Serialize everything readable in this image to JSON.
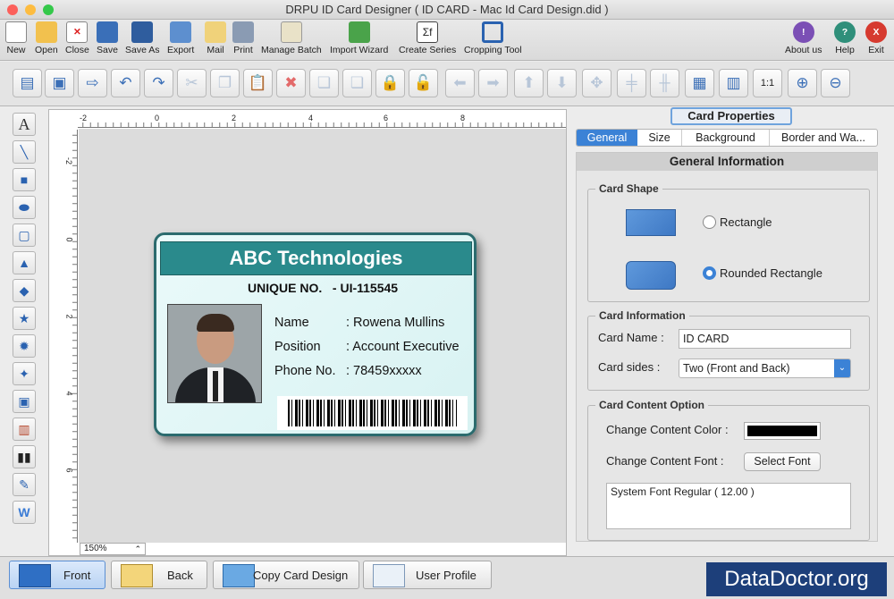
{
  "window": {
    "title": "DRPU ID Card Designer ( ID CARD - Mac Id Card Design.did )"
  },
  "toolbar": {
    "items": [
      "New",
      "Open",
      "Close",
      "Save",
      "Save As",
      "Export",
      "Mail",
      "Print",
      "Manage Batch",
      "Import Wizard",
      "Create Series",
      "Cropping Tool"
    ],
    "right": [
      "About us",
      "Help",
      "Exit"
    ]
  },
  "canvas": {
    "zoom": "150%",
    "ruler_top": [
      "-2",
      "0",
      "2",
      "4",
      "6",
      "8"
    ],
    "ruler_left": [
      "-2",
      "0",
      "2",
      "4",
      "6"
    ]
  },
  "card": {
    "company": "ABC Technologies",
    "unique_label": "UNIQUE NO.",
    "unique_value": "- UI-115545",
    "fields": [
      {
        "label": "Name",
        "value": ": Rowena Mullins"
      },
      {
        "label": "Position",
        "value": ": Account Executive"
      },
      {
        "label": "Phone No.",
        "value": ": 78459xxxxx"
      }
    ]
  },
  "panel": {
    "title": "Card Properties",
    "tabs": [
      "General",
      "Size",
      "Background",
      "Border and Wa..."
    ],
    "header": "General Information",
    "shape": {
      "title": "Card Shape",
      "options": [
        "Rectangle",
        "Rounded Rectangle"
      ],
      "selected": 1
    },
    "info": {
      "title": "Card Information",
      "name_label": "Card Name :",
      "name_value": "ID CARD",
      "sides_label": "Card sides :",
      "sides_value": "Two (Front and Back)"
    },
    "content": {
      "title": "Card Content Option",
      "color_label": "Change Content Color :",
      "font_label": "Change Content Font :",
      "font_button": "Select Font",
      "font_value": "System Font Regular ( 12.00 )"
    }
  },
  "bottom": {
    "buttons": [
      "Front",
      "Back",
      "Copy Card Design",
      "User Profile"
    ],
    "brand": "DataDoctor.org"
  },
  "colors": {
    "accent": "#3b82d6",
    "card_header": "#2a8a8c",
    "brand_bg": "#1d3f7a"
  }
}
